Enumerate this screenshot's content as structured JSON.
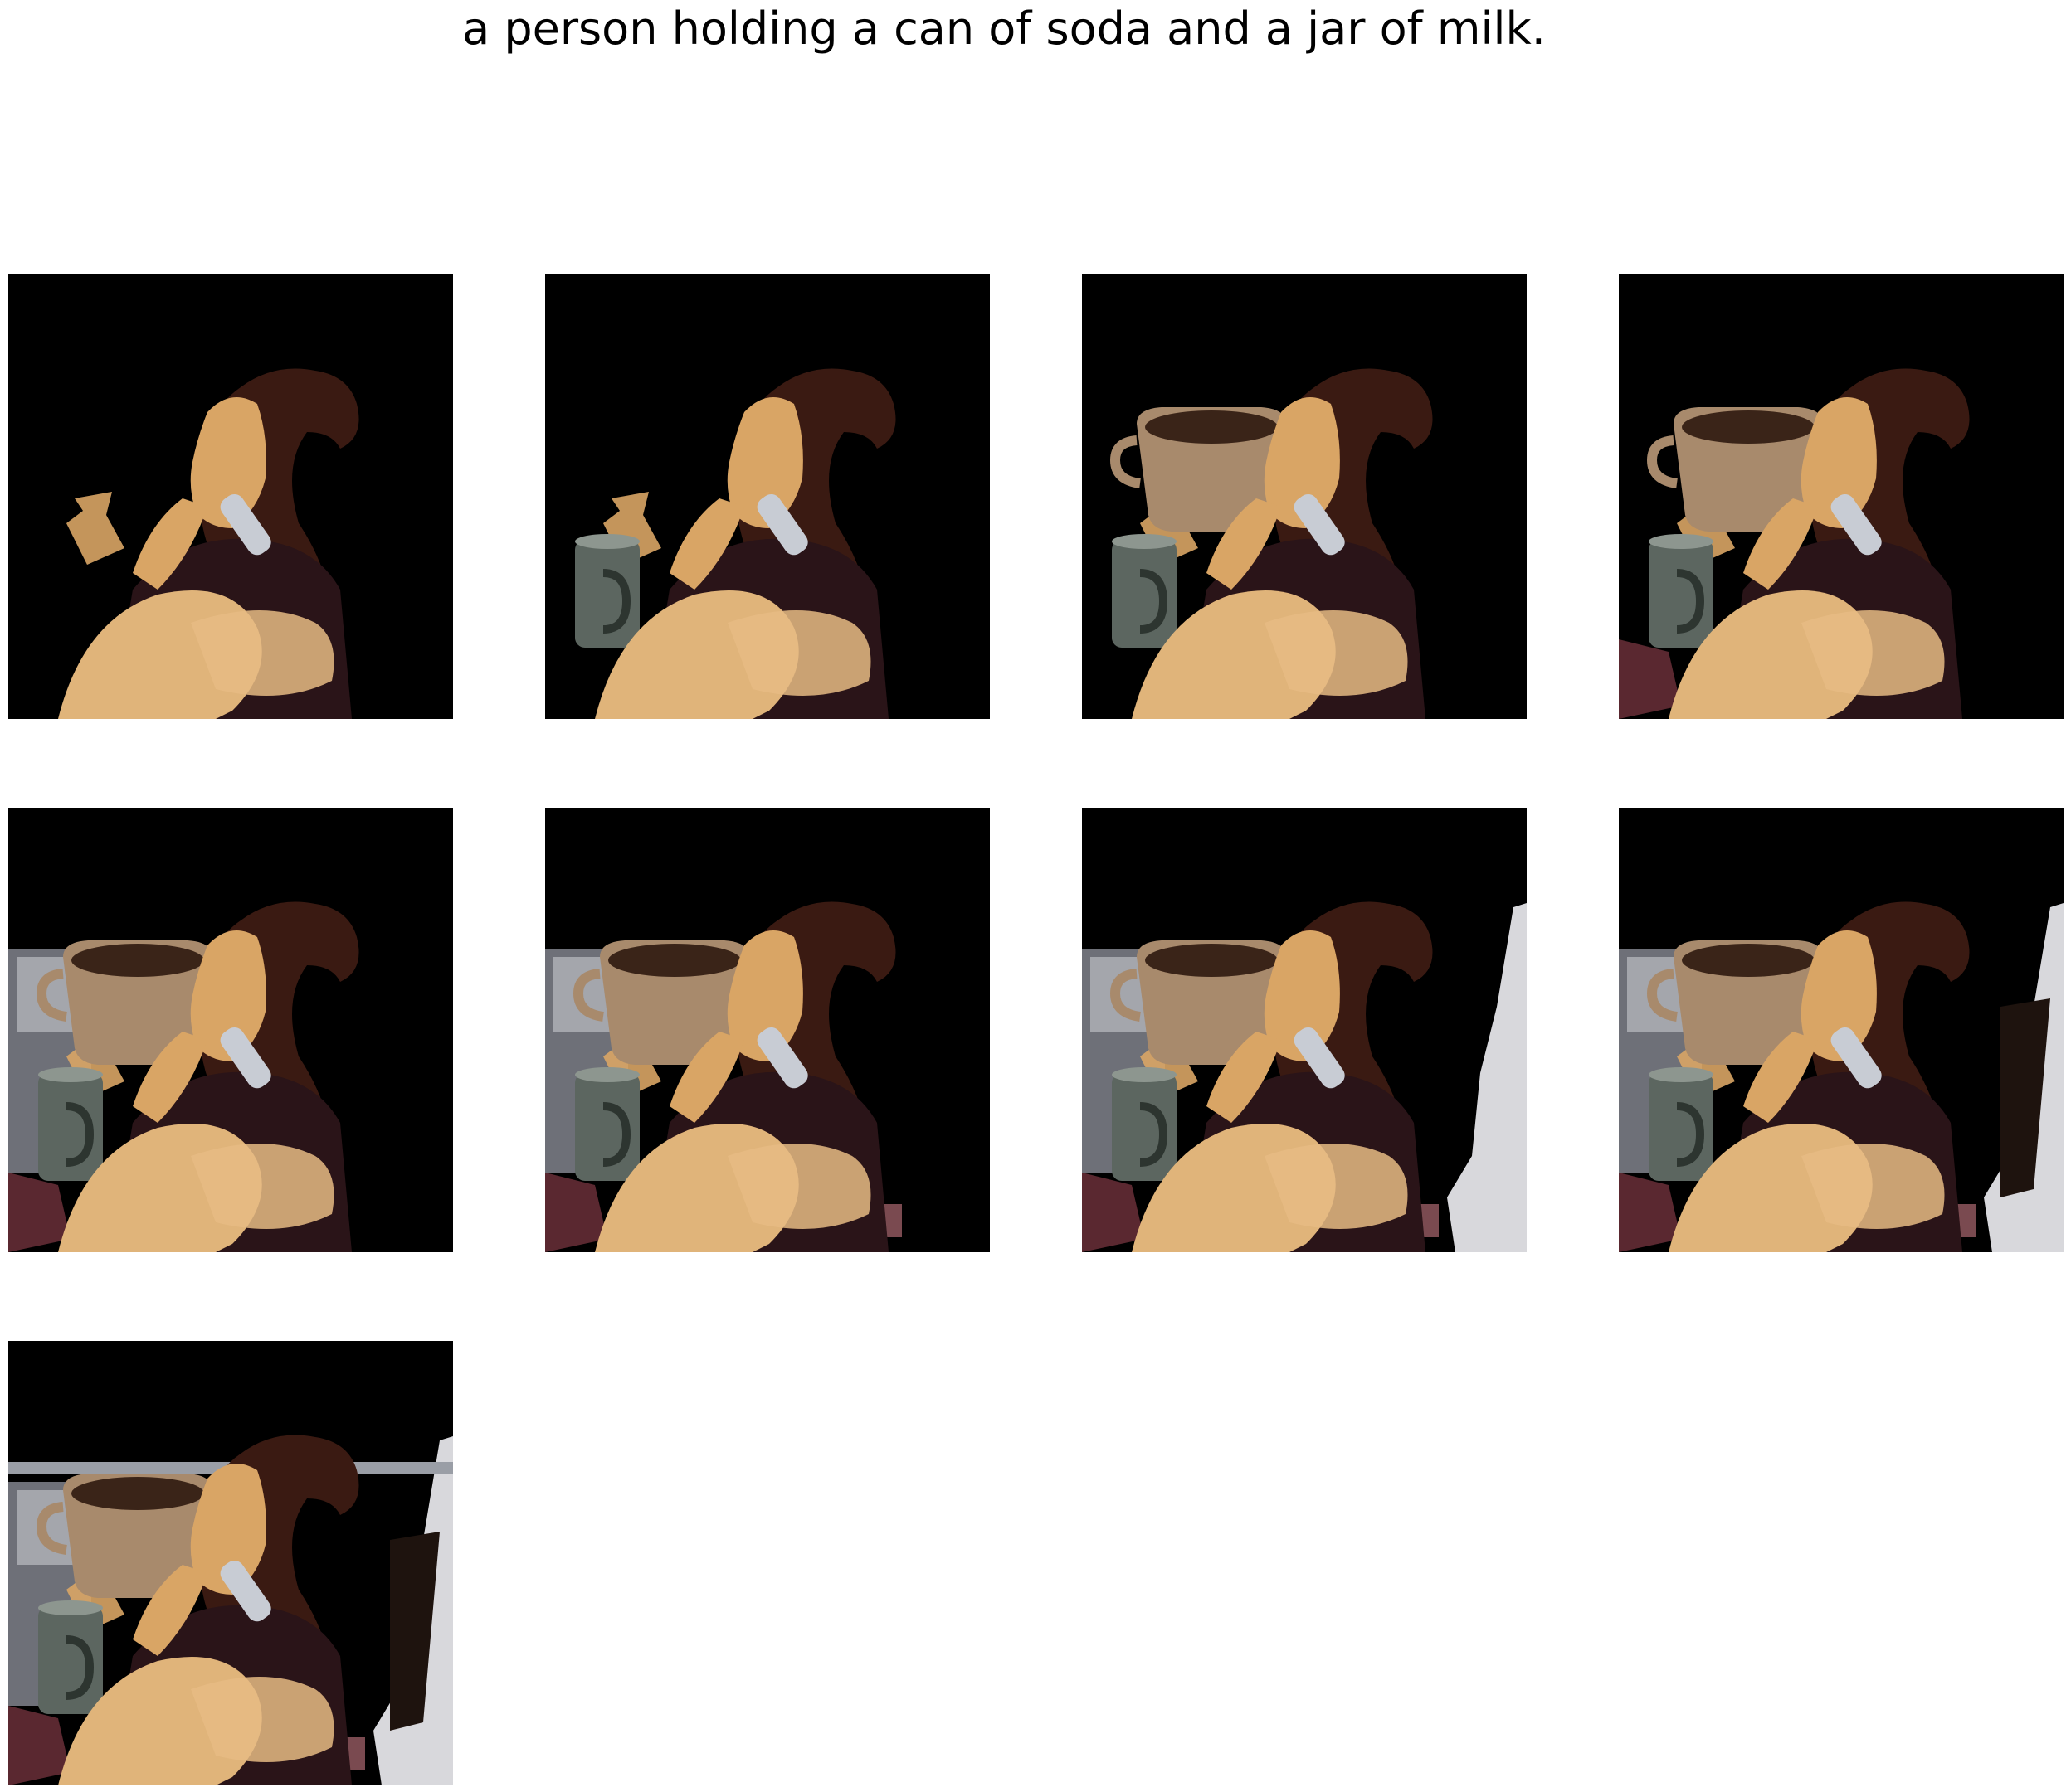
{
  "caption": "a person holding a can of soda and a jar of milk.",
  "colors": {
    "background": "#000000",
    "skin": "#d9a565",
    "hair": "#3a1a12",
    "shirt": "#2a1418",
    "phone": "#c8ccd4",
    "cup": "#a88a6c",
    "mug": "#5c6660",
    "wall": "#d8d8dc",
    "table": "#5a2830"
  },
  "panels": [
    {
      "id": "step-1",
      "layers": [
        "arm-fragment",
        "person"
      ]
    },
    {
      "id": "step-2",
      "layers": [
        "arm-fragment",
        "mug",
        "person"
      ]
    },
    {
      "id": "step-3",
      "layers": [
        "arm-fragment",
        "mug",
        "cup",
        "person"
      ]
    },
    {
      "id": "step-4",
      "layers": [
        "arm-fragment",
        "mug",
        "cup",
        "table-left",
        "person"
      ]
    },
    {
      "id": "step-5",
      "layers": [
        "window-left",
        "arm-fragment",
        "mug",
        "cup",
        "table-left",
        "person"
      ]
    },
    {
      "id": "step-6",
      "layers": [
        "window-left",
        "arm-fragment",
        "mug",
        "cup",
        "table-left",
        "table-strip",
        "person"
      ]
    },
    {
      "id": "step-7",
      "layers": [
        "window-left",
        "arm-fragment",
        "mug",
        "cup",
        "table-left",
        "table-strip",
        "wall-right",
        "person"
      ]
    },
    {
      "id": "step-8",
      "layers": [
        "window-left",
        "arm-fragment",
        "mug",
        "cup",
        "table-left",
        "table-strip",
        "wall-right",
        "dark-panel",
        "person"
      ]
    },
    {
      "id": "step-9",
      "layers": [
        "window-left",
        "arm-fragment",
        "mug",
        "cup",
        "table-left",
        "table-strip",
        "wall-right",
        "dark-panel",
        "top-band",
        "person"
      ]
    }
  ]
}
